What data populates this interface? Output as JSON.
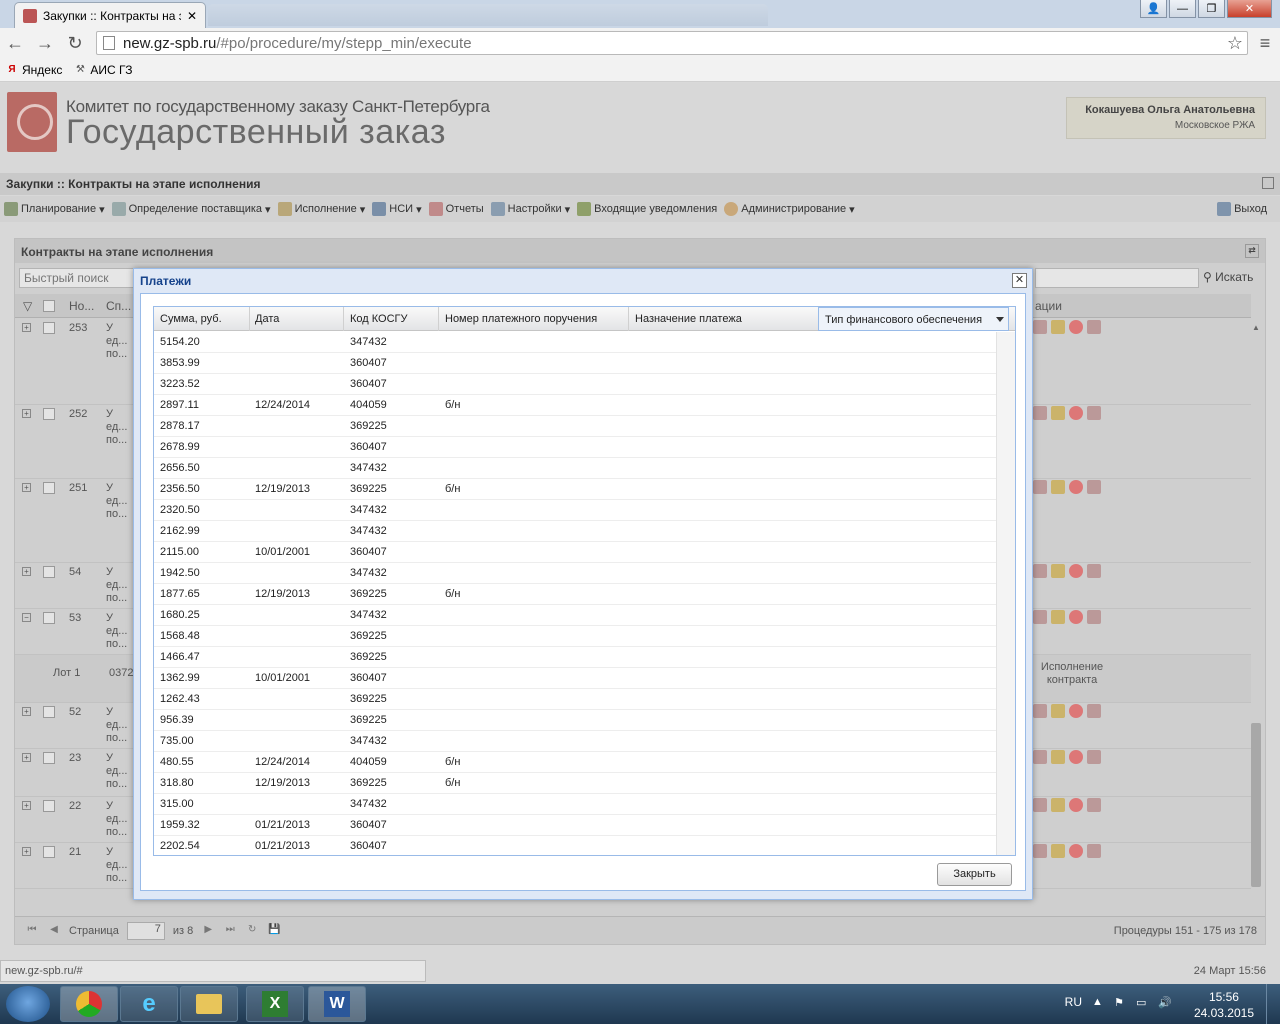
{
  "browser": {
    "tab_title": "Закупки :: Контракты на э",
    "url_host": "new.gz-spb.ru",
    "url_path": "/#po/procedure/my/stepp_min/execute",
    "bookmarks": [
      "Яндекс",
      "АИС ГЗ"
    ]
  },
  "header": {
    "org": "Комитет по государственному заказу Санкт-Петербурга",
    "title": "Государственный заказ",
    "user_name": "Кокашуева Ольга Анатольевна",
    "user_org": "Московское РЖА"
  },
  "app_title": "Закупки :: Контракты на этапе исполнения",
  "menu": {
    "items": [
      "Планирование",
      "Определение поставщика",
      "Исполнение",
      "НСИ",
      "Отчеты",
      "Настройки",
      "Входящие уведомления",
      "Администрирование"
    ],
    "exit": "Выход"
  },
  "panel": {
    "title": "Контракты на этапе исполнения",
    "quick_search_placeholder": "Быстрый поиск",
    "search_button": "Искать",
    "col_no": "Но...",
    "col_sp": "Сп...",
    "col_ops": "ации",
    "rows": [
      {
        "no": "253",
        "l1": "У",
        "l2": "ед...",
        "l3": "по..."
      },
      {
        "no": "252",
        "l1": "У",
        "l2": "ед...",
        "l3": "по..."
      },
      {
        "no": "251",
        "l1": "У",
        "l2": "ед...",
        "l3": "по..."
      },
      {
        "no": "54",
        "l1": "У",
        "l2": "ед...",
        "l3": "по..."
      },
      {
        "no": "53",
        "l1": "У",
        "l2": "ед...",
        "l3": "по..."
      },
      {
        "no": "52",
        "l1": "У",
        "l2": "ед...",
        "l3": "по..."
      },
      {
        "no": "23",
        "l1": "У",
        "l2": "ед...",
        "l3": "по..."
      },
      {
        "no": "22",
        "l1": "У",
        "l2": "ед...",
        "l3": "по..."
      },
      {
        "no": "21",
        "l1": "У",
        "l2": "ед...",
        "l3": "по..."
      }
    ],
    "lot": {
      "label": "Лот 1",
      "no": "0372",
      "status": "Исполнение контракта"
    },
    "pager": {
      "page_label": "Страница",
      "page": "7",
      "of": "из 8",
      "summary": "Процедуры 151 - 175 из 178"
    }
  },
  "modal": {
    "title": "Платежи",
    "columns": [
      "Сумма, руб.",
      "Дата",
      "Код КОСГУ",
      "Номер платежного поручения",
      "Назначение платежа",
      "Тип финансового обеспечения"
    ],
    "rows": [
      [
        "5154.20",
        "",
        "347432",
        ""
      ],
      [
        "3853.99",
        "",
        "360407",
        ""
      ],
      [
        "3223.52",
        "",
        "360407",
        ""
      ],
      [
        "2897.11",
        "12/24/2014",
        "404059",
        "б/н"
      ],
      [
        "2878.17",
        "",
        "369225",
        ""
      ],
      [
        "2678.99",
        "",
        "360407",
        ""
      ],
      [
        "2656.50",
        "",
        "347432",
        ""
      ],
      [
        "2356.50",
        "12/19/2013",
        "369225",
        "б/н"
      ],
      [
        "2320.50",
        "",
        "347432",
        ""
      ],
      [
        "2162.99",
        "",
        "347432",
        ""
      ],
      [
        "2115.00",
        "10/01/2001",
        "360407",
        ""
      ],
      [
        "1942.50",
        "",
        "347432",
        ""
      ],
      [
        "1877.65",
        "12/19/2013",
        "369225",
        "б/н"
      ],
      [
        "1680.25",
        "",
        "347432",
        ""
      ],
      [
        "1568.48",
        "",
        "369225",
        ""
      ],
      [
        "1466.47",
        "",
        "369225",
        ""
      ],
      [
        "1362.99",
        "10/01/2001",
        "360407",
        ""
      ],
      [
        "1262.43",
        "",
        "369225",
        ""
      ],
      [
        "956.39",
        "",
        "369225",
        ""
      ],
      [
        "735.00",
        "",
        "347432",
        ""
      ],
      [
        "480.55",
        "12/24/2014",
        "404059",
        "б/н"
      ],
      [
        "318.80",
        "12/19/2013",
        "369225",
        "б/н"
      ],
      [
        "315.00",
        "",
        "347432",
        ""
      ],
      [
        "1959.32",
        "01/21/2013",
        "360407",
        ""
      ],
      [
        "2202.54",
        "01/21/2013",
        "360407",
        ""
      ]
    ],
    "close_button": "Закрыть"
  },
  "status": {
    "url": "new.gz-spb.ru/#",
    "datetime": "24 Март 15:56"
  },
  "taskbar": {
    "lang": "RU",
    "time": "15:56",
    "date": "24.03.2015"
  }
}
